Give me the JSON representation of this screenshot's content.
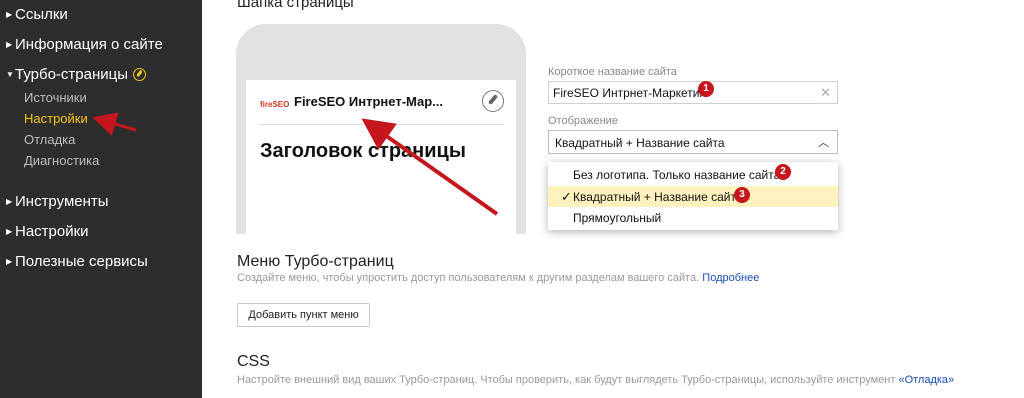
{
  "sidebar": {
    "items": [
      {
        "label": "Ссылки"
      },
      {
        "label": "Информация о сайте"
      },
      {
        "label": "Турбо-страницы"
      },
      {
        "label": "Инструменты"
      },
      {
        "label": "Настройки"
      },
      {
        "label": "Полезные сервисы"
      }
    ],
    "turbo_subitems": [
      {
        "label": "Источники"
      },
      {
        "label": "Настройки"
      },
      {
        "label": "Отладка"
      },
      {
        "label": "Диагностика"
      }
    ]
  },
  "header_section": {
    "title": "Шапка страницы",
    "preview": {
      "logo_text": "fireSEO",
      "site_name": "FireSEO Интрнет-Мар...",
      "page_heading": "Заголовок страницы"
    },
    "short_name_label": "Короткое название сайта",
    "short_name_value": "FireSEO Интрнет-Маркетинг",
    "display_label": "Отображение",
    "display_value": "Квадратный + Название сайта",
    "display_options": [
      {
        "label": "Без логотипа. Только название сайта"
      },
      {
        "label": "Квадратный + Название сайта"
      },
      {
        "label": "Прямоугольный"
      }
    ]
  },
  "menu_section": {
    "title": "Меню Турбо-страниц",
    "description": "Создайте меню, чтобы упростить доступ пользователям к другим разделам вашего сайта.",
    "link": "Подробнее",
    "add_button": "Добавить пункт меню"
  },
  "css_section": {
    "title": "CSS",
    "description": "Настройте внешний вид ваших Турбо-страниц. Чтобы проверить, как будут выглядеть Турбо-страницы, используйте инструмент",
    "link": "«Отладка»"
  },
  "badges": [
    "1",
    "2",
    "3"
  ],
  "colors": {
    "sidebar_bg": "#2d2d2d",
    "active_yellow": "#f5c518",
    "annotation_red": "#c5161d",
    "link_blue": "#1a4fb8",
    "selected_option_bg": "#fff2bf"
  }
}
